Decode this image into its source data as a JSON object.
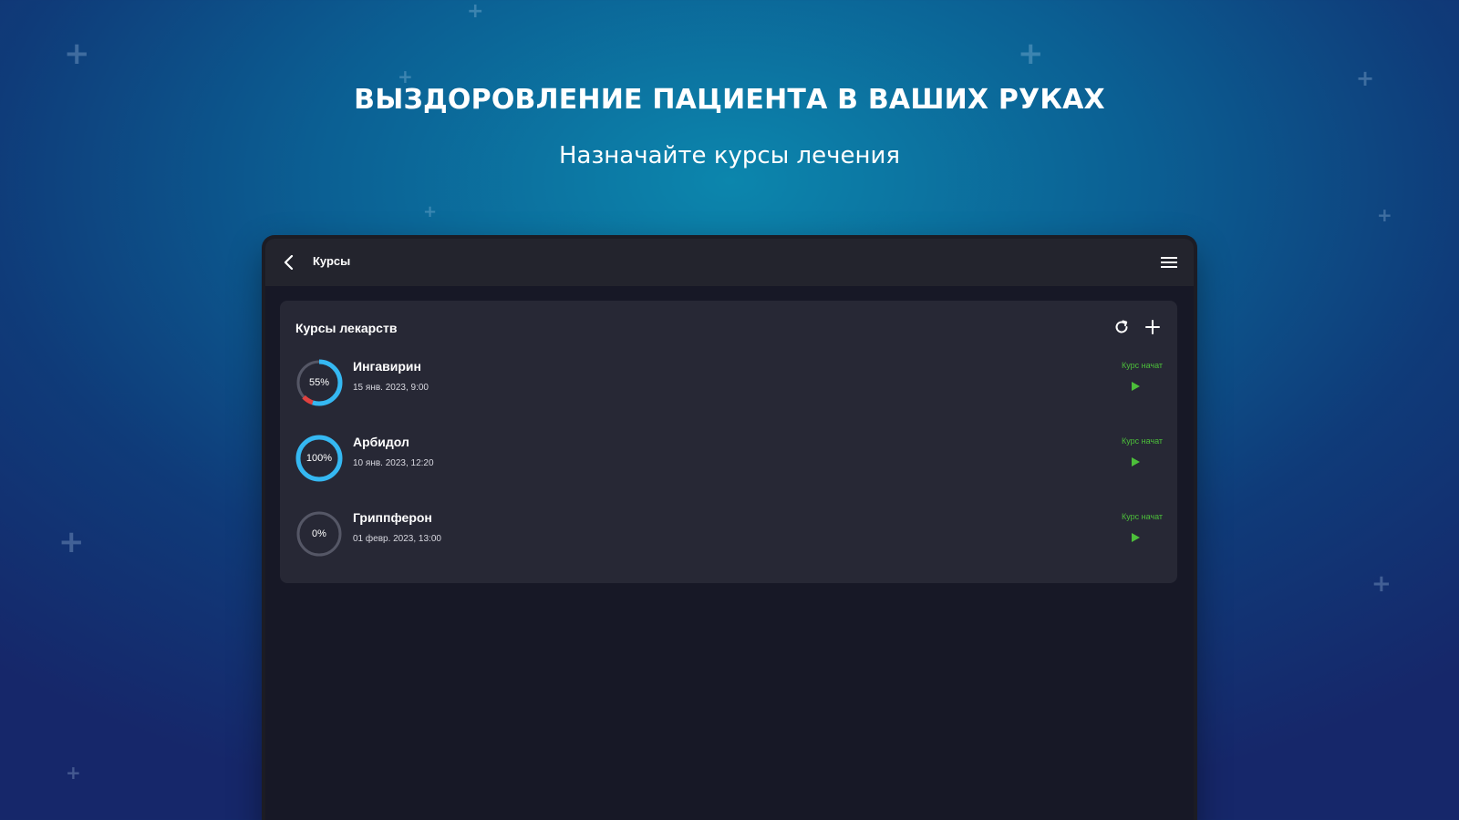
{
  "promo": {
    "headline": "ВЫЗДОРОВЛЕНИЕ ПАЦИЕНТА В ВАШИХ РУКАХ",
    "subheadline": "Назначайте курсы лечения"
  },
  "appbar": {
    "title": "Курсы",
    "back_icon": "chevron-left-icon",
    "menu_icon": "hamburger-menu-icon"
  },
  "card": {
    "title": "Курсы лекарств",
    "refresh_icon": "refresh-icon",
    "add_icon": "plus-icon"
  },
  "courses": [
    {
      "name": "Ингавирин",
      "date": "15 янв. 2023, 9:00",
      "progress_label": "55%",
      "progress": 0.55,
      "progress_color": "#35b8f2",
      "missed_color": "#e0413f",
      "missed": 0.08,
      "status": "Курс начат",
      "action_icon": "play-icon"
    },
    {
      "name": "Арбидол",
      "date": "10 янв. 2023, 12:20",
      "progress_label": "100%",
      "progress": 1.0,
      "progress_color": "#35b8f2",
      "missed_color": "#e0413f",
      "missed": 0,
      "status": "Курс начат",
      "action_icon": "play-icon"
    },
    {
      "name": "Гриппферон",
      "date": "01 февр. 2023, 13:00",
      "progress_label": "0%",
      "progress": 0,
      "progress_color": "#35b8f2",
      "missed_color": "#e0413f",
      "missed": 0,
      "status": "Курс начат",
      "action_icon": "play-icon"
    }
  ],
  "colors": {
    "accent": "#35b8f2",
    "status_green": "#4cbf3a",
    "card_bg": "#272835",
    "app_bg": "#171826"
  }
}
